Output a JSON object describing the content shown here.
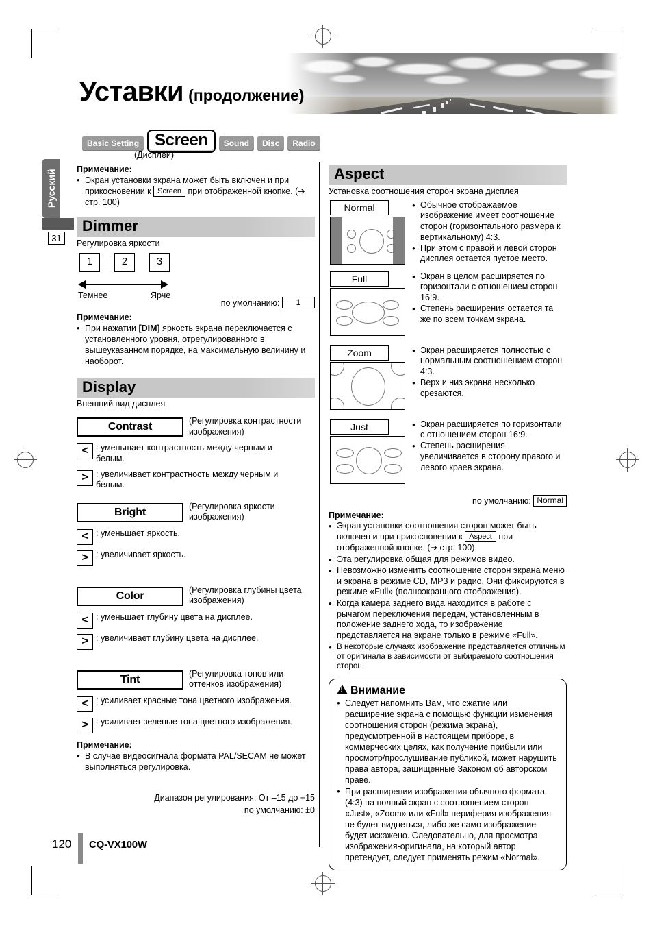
{
  "header": {
    "title_main": "Уставки",
    "title_sub": "(продолжение)",
    "banner_alt": "road-photo"
  },
  "sidebar": {
    "language_tab": "Русский",
    "chapter_number": "31"
  },
  "tabs": {
    "items": [
      {
        "label": "Basic Setting",
        "active": false
      },
      {
        "label": "Screen",
        "active": true
      },
      {
        "label": "Sound",
        "active": false
      },
      {
        "label": "Disc",
        "active": false
      },
      {
        "label": "Radio",
        "active": false
      }
    ],
    "caption": "(Дисплей)"
  },
  "screen_note": {
    "heading": "Примечание:",
    "item_a": "Экран установки экрана может быть включен и при",
    "item_b": "прикосновении к",
    "key": "Screen",
    "item_c": "при отображенной кнопке.",
    "item_d": "(➔ стр. 100)"
  },
  "dimmer": {
    "title": "Dimmer",
    "subtitle": "Регулировка яркости",
    "levels": [
      "1",
      "2",
      "3"
    ],
    "label_left": "Темнее",
    "label_right": "Ярче",
    "default_label": "по умолчанию:",
    "default_value": "1",
    "note_heading": "Примечание:",
    "note_text": "При нажатии [DIM] яркость экрана переключается с установленного уровня, отрегулированного в вышеуказанном порядке, на максимальную величину и наоборот.",
    "note_bold_part": "[DIM]",
    "note_pre": "При нажатии ",
    "note_post": " яркость экрана переключается с установленного уровня, отрегулированного в вышеуказанном порядке, на максимальную величину и наоборот."
  },
  "display": {
    "title": "Display",
    "subtitle": "Внешний вид дисплея",
    "params": [
      {
        "name": "Contrast",
        "desc": "(Регулировка контрастности изображения)",
        "less": ": уменьшает контрастность между черным и белым.",
        "more": ": увеличивает контрастность между черным и белым."
      },
      {
        "name": "Bright",
        "desc": "(Регулировка яркости изображения)",
        "less": ": уменьшает яркость.",
        "more": ": увеличивает яркость."
      },
      {
        "name": "Color",
        "desc": "(Регулировка глубины цвета изображения)",
        "less": ": уменьшает глубину цвета на дисплее.",
        "more": ": увеличивает глубину цвета на дисплее."
      },
      {
        "name": "Tint",
        "desc": "(Регулировка тонов или оттенков изображения)",
        "less": ": усиливает красные тона цветного изображения.",
        "more": ": усиливает зеленые тона цветного изображения."
      }
    ],
    "btn_less": "<",
    "btn_more": ">",
    "note_heading": "Примечание:",
    "note_text": "В случае видеосигнала формата PAL/SECAM не может выполняться регулировка.",
    "range_line": "Диапазон регулирования: От –15 до +15",
    "default_line": "по умолчанию: ±0"
  },
  "aspect": {
    "title": "Aspect",
    "subtitle": "Установка соотношения сторон экрана дисплея",
    "modes": [
      {
        "label": "Normal",
        "figure": "normal",
        "bullets": [
          "Обычное отображаемое изображение имеет соотношение сторон (горизонтального размера к вертикальному) 4:3.",
          "При этом с правой и левой сторон дисплея остается пустое место."
        ]
      },
      {
        "label": "Full",
        "figure": "full",
        "bullets": [
          "Экран в целом расширяется по горизонтали с отношением сторон 16:9.",
          "Степень расширения остается та же по всем точкам экрана."
        ]
      },
      {
        "label": "Zoom",
        "figure": "zoom",
        "bullets": [
          "Экран расширяется полностью с нормальным соотношением сторон 4:3.",
          "Верх и низ экрана несколько срезаются."
        ]
      },
      {
        "label": "Just",
        "figure": "just",
        "bullets": [
          "Экран расширяется по горизонтали с отношением сторон 16:9.",
          "Степень расширения увеличивается в сторону правого и левого краев экрана."
        ]
      }
    ],
    "default_label": "по умолчанию:",
    "default_value": "Normal",
    "note_heading": "Примечание:",
    "notes": [
      {
        "pre": "Экран установки соотношения сторон может быть включен и при прикосновении к ",
        "key": "Aspect",
        "post": " при отображенной кнопке. (➔ стр. 100)"
      },
      {
        "pre": "Эта регулировка общая для режимов видео.",
        "key": "",
        "post": ""
      },
      {
        "pre": "Невозможно изменить соотношение сторон экрана меню и экрана в режиме CD, MP3 и радио. Они фиксируются в режиме «Full» (полноэкранного отображения).",
        "key": "",
        "post": ""
      },
      {
        "pre": "Когда камера заднего вида находится в работе с рычагом переключения передач, установленным в положение заднего хода, то изображение представляется на экране только в режиме «Full».",
        "key": "",
        "post": ""
      },
      {
        "pre": "В некоторые случаях изображение представляется отличным от оригинала в зависимости от выбираемого соотношения сторон.",
        "key": "",
        "post": ""
      }
    ]
  },
  "caution": {
    "heading": "Внимание",
    "icon": "warning-triangle-icon",
    "items": [
      "Следует напомнить Вам, что сжатие или расширение экрана с помощью функции изменения соотношения сторон (режима экрана), предусмотренной в настоящем приборе, в коммерческих целях, как получение прибыли или просмотр/прослушивание публикой, может нарушить права автора, защищенные Законом об авторском праве.",
      "При расширении изображения обычного формата (4:3) на полный экран с соотношением сторон «Just», «Zoom» или «Full» периферия изображения не будет виднеться, либо же само изображение будет искажено. Следовательно, для просмотра изображения-оригинала, на который автор претендует, следует применять режим «Normal»."
    ]
  },
  "footer": {
    "page_number": "120",
    "model": "CQ-VX100W"
  },
  "colors": {
    "section_header_bg": "#c7c7c7",
    "tab_inactive_bg": "#9a9a9a",
    "sidebar_tab_bg": "#6f6f6f",
    "figure_bar_gray": "#808080"
  }
}
